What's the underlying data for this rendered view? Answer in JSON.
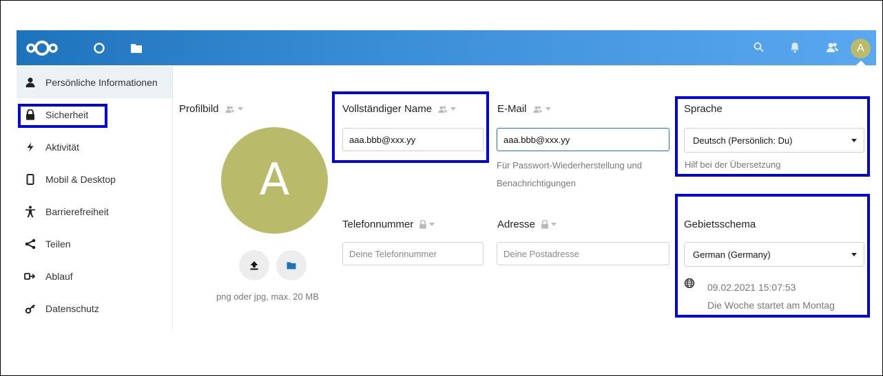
{
  "header": {
    "apps": [
      "dashboard-icon",
      "files-icon"
    ],
    "right_icons": [
      "search-icon",
      "bell-icon",
      "contacts-icon"
    ],
    "avatar_letter": "A",
    "colors": {
      "bar_start": "#1e74bc",
      "bar_end": "#5aa8ef",
      "avatar": "#b9bb6b"
    }
  },
  "sidebar": {
    "items": [
      {
        "label": "Persönliche Informationen",
        "icon": "person-icon"
      },
      {
        "label": "Sicherheit",
        "icon": "lock-icon"
      },
      {
        "label": "Aktivität",
        "icon": "lightning-icon"
      },
      {
        "label": "Mobil & Desktop",
        "icon": "phone-icon"
      },
      {
        "label": "Barrierefreiheit",
        "icon": "accessibility-icon"
      },
      {
        "label": "Teilen",
        "icon": "share-icon"
      },
      {
        "label": "Ablauf",
        "icon": "workflow-icon"
      },
      {
        "label": "Datenschutz",
        "icon": "key-icon"
      }
    ]
  },
  "profile": {
    "label": "Profilbild",
    "avatar_letter": "A",
    "hint": "png oder jpg, max. 20 MB"
  },
  "fullname": {
    "label": "Vollständiger Name",
    "value": "aaa.bbb@xxx.yy"
  },
  "email": {
    "label": "E-Mail",
    "value": "aaa.bbb@xxx.yy",
    "hint_line1": "Für Passwort-Wiederherstellung und",
    "hint_line2": "Benachrichtigungen"
  },
  "phone": {
    "label": "Telefonnummer",
    "placeholder": "Deine Telefonnummer"
  },
  "address": {
    "label": "Adresse",
    "placeholder": "Deine Postadresse"
  },
  "language": {
    "label": "Sprache",
    "selected": "Deutsch (Persönlich: Du)",
    "hint": "Hilf bei der Übersetzung"
  },
  "locale": {
    "label": "Gebietsschema",
    "selected": "German (Germany)",
    "datetime": "09.02.2021 15:07:53",
    "week_start": "Die Woche startet am Montag"
  },
  "highlight_color": "#0000dd"
}
